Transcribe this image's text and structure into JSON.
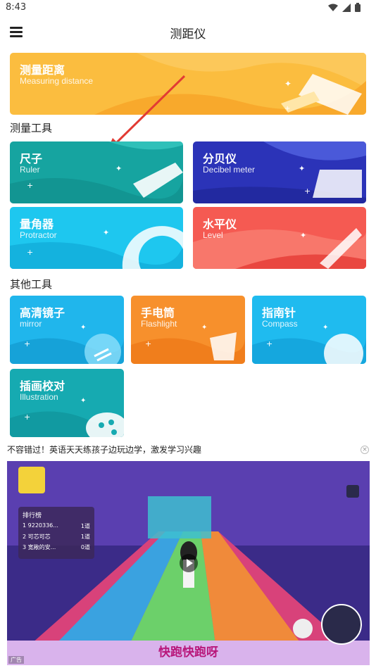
{
  "status_bar": {
    "time": "8:43"
  },
  "app_bar": {
    "title": "测距仪"
  },
  "banner": {
    "title": "测量距离",
    "subtitle": "Measuring distance"
  },
  "sections": {
    "measure": "测量工具",
    "other": "其他工具"
  },
  "measure_tools": [
    {
      "title": "尺子",
      "subtitle": "Ruler"
    },
    {
      "title": "分贝仪",
      "subtitle": "Decibel meter"
    },
    {
      "title": "量角器",
      "subtitle": "Protractor"
    },
    {
      "title": "水平仪",
      "subtitle": "Level"
    }
  ],
  "other_tools": [
    {
      "title": "高清镜子",
      "subtitle": "mirror"
    },
    {
      "title": "手电筒",
      "subtitle": "Flashlight"
    },
    {
      "title": "指南针",
      "subtitle": "Compass"
    },
    {
      "title": "插画校对",
      "subtitle": "Illustration"
    }
  ],
  "ad": {
    "headline": "不容错过！英语天天练孩子边玩边学，激发学习兴趣",
    "close": "×",
    "leaderboard_title": "排行榜",
    "leaderboard": [
      {
        "name": "1 9220336...",
        "score": "1道"
      },
      {
        "name": "2 可芯可芯",
        "score": "1道"
      },
      {
        "name": "3 宽敞的安...",
        "score": "0道"
      }
    ],
    "caption": "快跑快跑呀",
    "badge": "广告"
  },
  "colors": {
    "banner": "#fbbd3f",
    "ruler": "#16a4a0",
    "decibel": "#2b33b8",
    "protractor": "#1ec7ef",
    "level": "#f55a52",
    "mirror": "#20b6ec",
    "flashlight": "#f7902c",
    "compass": "#1fbbef",
    "illustration": "#16aab1"
  }
}
